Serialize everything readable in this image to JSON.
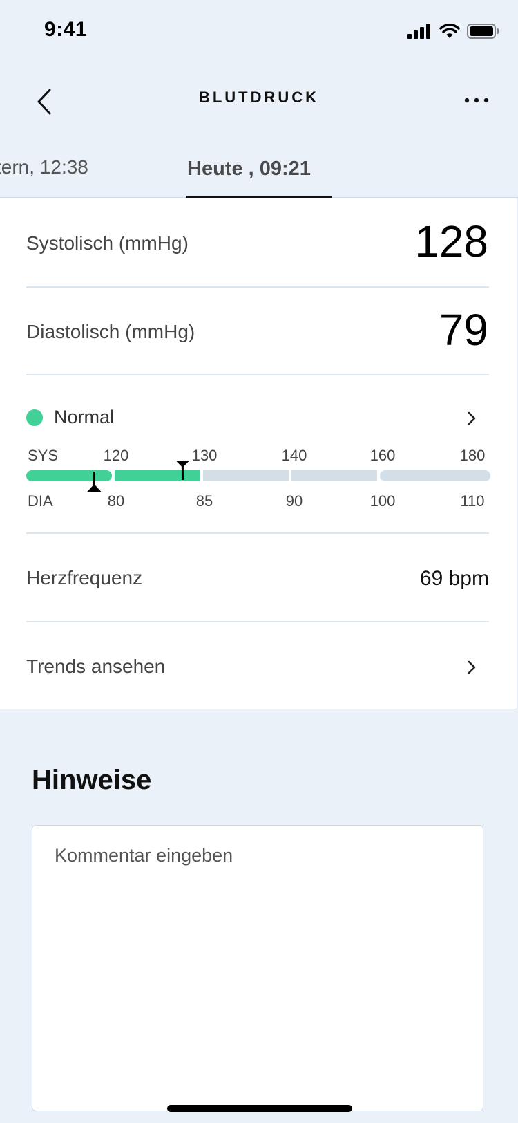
{
  "status_bar": {
    "time": "9:41"
  },
  "nav": {
    "title": "BLUTDRUCK",
    "back_icon": "chevron-left-icon",
    "more_icon": "ellipsis-icon"
  },
  "tabs": [
    {
      "label": "tern, 12:38",
      "active": false
    },
    {
      "label": "Heute , 09:21",
      "active": true
    }
  ],
  "measurements": {
    "systolic": {
      "label": "Systolisch (mmHg)",
      "value": "128"
    },
    "diastolic": {
      "label": "Diastolisch (mmHg)",
      "value": "79"
    }
  },
  "classification": {
    "label": "Normal",
    "color": "#40D098",
    "scale": {
      "sys_label": "SYS",
      "dia_label": "DIA",
      "sys_ticks": [
        "120",
        "130",
        "140",
        "160",
        "180"
      ],
      "dia_ticks": [
        "80",
        "85",
        "90",
        "100",
        "110"
      ],
      "segment_colors": [
        "#40D098",
        "#40D098",
        "#D3DEE6",
        "#D3DEE6",
        "#D3DEE6"
      ],
      "sys_marker_value": 128,
      "dia_marker_value": 79
    }
  },
  "heart_rate": {
    "label": "Herzfrequenz",
    "value": "69 bpm"
  },
  "trends": {
    "label": "Trends ansehen"
  },
  "notes": {
    "title": "Hinweise",
    "placeholder": "Kommentar eingeben"
  }
}
